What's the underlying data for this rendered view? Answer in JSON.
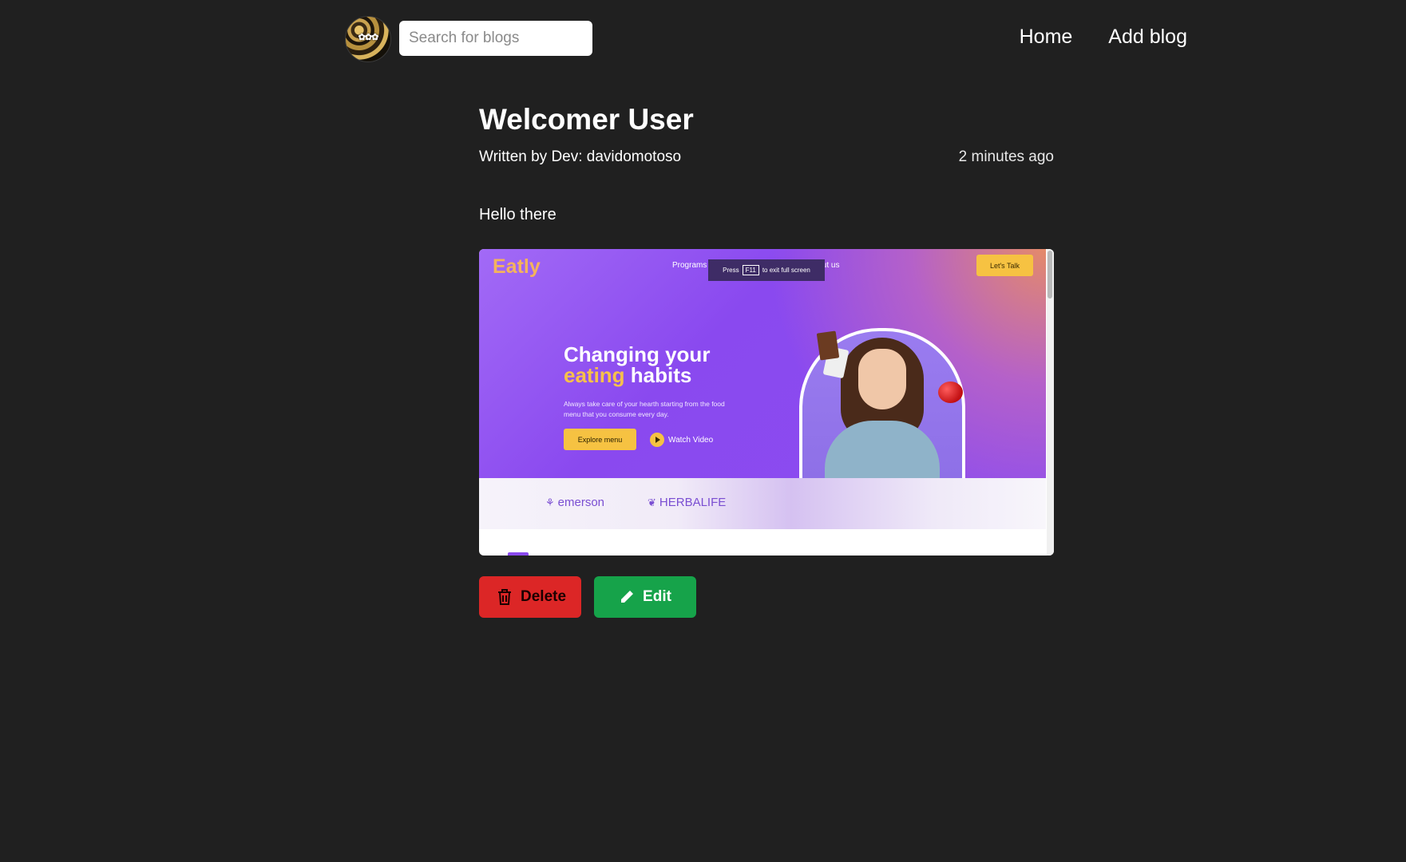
{
  "header": {
    "logo_text": "✿✿✿",
    "search_placeholder": "Search for blogs",
    "nav_links": [
      "Home",
      "Add blog"
    ]
  },
  "post": {
    "title": "Welcomer User",
    "author_line": "Written by Dev: davidomotoso",
    "time_ago": "2 minutes ago",
    "body": "Hello there"
  },
  "embedded_screenshot": {
    "brand": "Eatly",
    "menu_left": "Programs",
    "menu_right": "About us",
    "fullscreen_notice_prefix": "Press",
    "fullscreen_notice_key": "F11",
    "fullscreen_notice_suffix": "to exit full screen",
    "cta": "Let's Talk",
    "headline_line1": "Changing your",
    "headline_accent": "eating",
    "headline_rest": " habits",
    "description": "Always take care of your hearth starting from the food menu that you consume every day.",
    "explore_button": "Explore menu",
    "watch_video": "Watch Video",
    "partners": [
      "emerson",
      "HERBALIFE"
    ]
  },
  "actions": {
    "delete_label": "Delete",
    "edit_label": "Edit"
  },
  "colors": {
    "background": "#202020",
    "delete": "#dc2626",
    "edit": "#16a34a",
    "accent_purple": "#8a49ef",
    "accent_yellow": "#f6c242"
  }
}
